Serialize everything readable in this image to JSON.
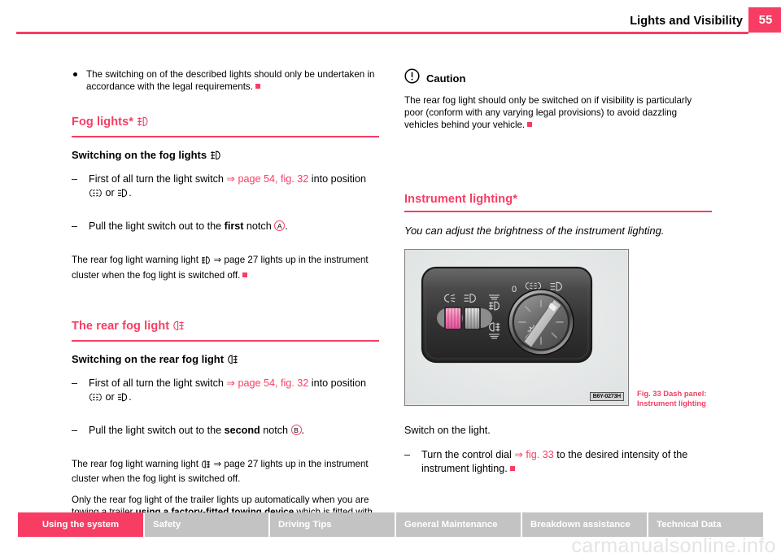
{
  "header": {
    "title": "Lights and Visibility",
    "page_number": "55"
  },
  "accent_color": "#f73d63",
  "left_column": {
    "intro_bullet": {
      "text": "The switching on of the described lights should only be undertaken in accordance with the legal requirements."
    },
    "fog_lights": {
      "section_heading": "Fog lights*",
      "sub_heading": "Switching on the fog lights",
      "step1_prefix": "First of all turn the light switch",
      "step1_xref": "⇒ page 54, fig. 32",
      "step1_suffix": "into position",
      "step1_line2_or": "or",
      "step2_prefix": "Pull the light switch out to the",
      "step2_bold": "first",
      "step2_mid": "notch",
      "step2_callout": "A",
      "note_part1": "The rear fog light warning light",
      "note_part2": "⇒ page 27",
      "note_part3": "lights up in the instrument cluster when the fog light is switched off."
    },
    "rear_fog_light": {
      "section_heading": "The rear fog light",
      "sub_heading": "Switching on the rear fog light",
      "step1_prefix": "First of all turn the light switch",
      "step1_xref": "⇒ page 54, fig. 32",
      "step1_suffix": "into position",
      "step1_line2_or": "or",
      "step2_prefix": "Pull the light switch out to the",
      "step2_bold": "second",
      "step2_mid": "notch",
      "step2_callout": "B",
      "note_part1": "The rear fog light warning light",
      "note_part2": "⇒ page 27",
      "note_part3": "lights up in the instrument cluster when the fog light is switched off.",
      "trailer_part1": "Only the rear fog light of the trailer lights up automatically when you are towing a trailer",
      "trailer_bold": "using a factory-fitted towing device",
      "trailer_part2": "which is fitted with the rear fog light ."
    }
  },
  "right_column": {
    "caution": {
      "label": "Caution",
      "icon": "exclamation-circle-icon",
      "text": "The rear fog light should only be switched on if visibility is particularly poor (conform with any varying legal provisions) to avoid dazzling vehicles behind your vehicle."
    },
    "instrument_lighting": {
      "section_heading": "Instrument lighting*",
      "intro_italic": "You can adjust the brightness of the instrument lighting.",
      "figure": {
        "image_id": "B6Y-0273H",
        "caption_line1": "Fig. 33   Dash panel:",
        "caption_line2": "Instrument lighting",
        "dial_labels": [
          "0"
        ],
        "switch_symbols": [
          "sidelights-icon",
          "headlights-icon",
          "fog-light-icon",
          "rear-fog-light-icon",
          "instrument-brightness-icon"
        ]
      },
      "body_text": "Switch on the light.",
      "step_prefix": "Turn the control dial",
      "step_xref": "⇒ fig. 33",
      "step_suffix": "to the desired intensity of the instrument lighting."
    }
  },
  "footer": {
    "tabs": [
      {
        "label": "Using the system",
        "active": true
      },
      {
        "label": "Safety",
        "active": false
      },
      {
        "label": "Driving Tips",
        "active": false
      },
      {
        "label": "General Maintenance",
        "active": false
      },
      {
        "label": "Breakdown assistance",
        "active": false
      },
      {
        "label": "Technical Data",
        "active": false
      }
    ],
    "watermark": "carmanualsonline.info"
  }
}
